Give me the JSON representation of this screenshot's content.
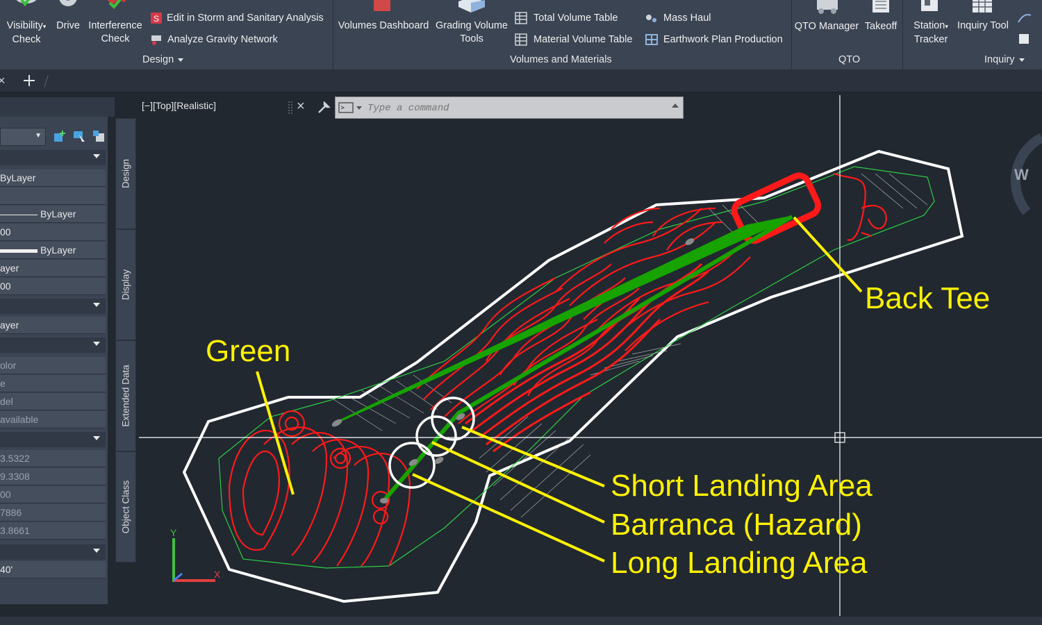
{
  "ribbon": {
    "visibility_check": [
      "Visibility",
      "Check"
    ],
    "drive": "Drive",
    "interference_check": [
      "Interference",
      "Check"
    ],
    "edit_storm": "Edit in Storm and Sanitary Analysis",
    "analyze_gravity": "Analyze Gravity Network",
    "design_panel": "Design",
    "volumes_dashboard": "Volumes Dashboard",
    "grading_volume_tools": [
      "Grading Volume",
      "Tools"
    ],
    "total_volume_table": "Total Volume Table",
    "material_volume_table": "Material Volume Table",
    "mass_haul": "Mass Haul",
    "earthwork_plan": "Earthwork Plan Production",
    "volumes_panel": "Volumes and Materials",
    "qto_manager": "QTO Manager",
    "takeoff": "Takeoff",
    "qto_panel": "QTO",
    "station_tracker": [
      "Station",
      "Tracker"
    ],
    "inquiry_tool": "Inquiry Tool",
    "inquiry_panel": "Inquiry"
  },
  "viewport": {
    "label": "[−][Top][Realistic]",
    "command_placeholder": "Type a command",
    "compass_letter": "W"
  },
  "palette": {
    "rows": [
      "ByLayer",
      "",
      "ByLayer",
      "00",
      "ByLayer",
      "ayer",
      "00",
      "ayer",
      "olor",
      "e",
      "del",
      "available",
      "3.5322",
      "9.3308",
      "00",
      "7886",
      "3.8661",
      "40'"
    ]
  },
  "side_tabs": [
    "Design",
    "Display",
    "Extended Data",
    "Object Class"
  ],
  "callouts": {
    "green": "Green",
    "back_tee": "Back Tee",
    "short_landing": "Short Landing Area",
    "barranca": "Barranca (Hazard)",
    "long_landing": "Long Landing Area"
  },
  "colors": {
    "contour": "#ff0000",
    "centerline": "#17a300",
    "callout": "#fff200",
    "boundary": "#ffffff",
    "background": "#212830"
  }
}
